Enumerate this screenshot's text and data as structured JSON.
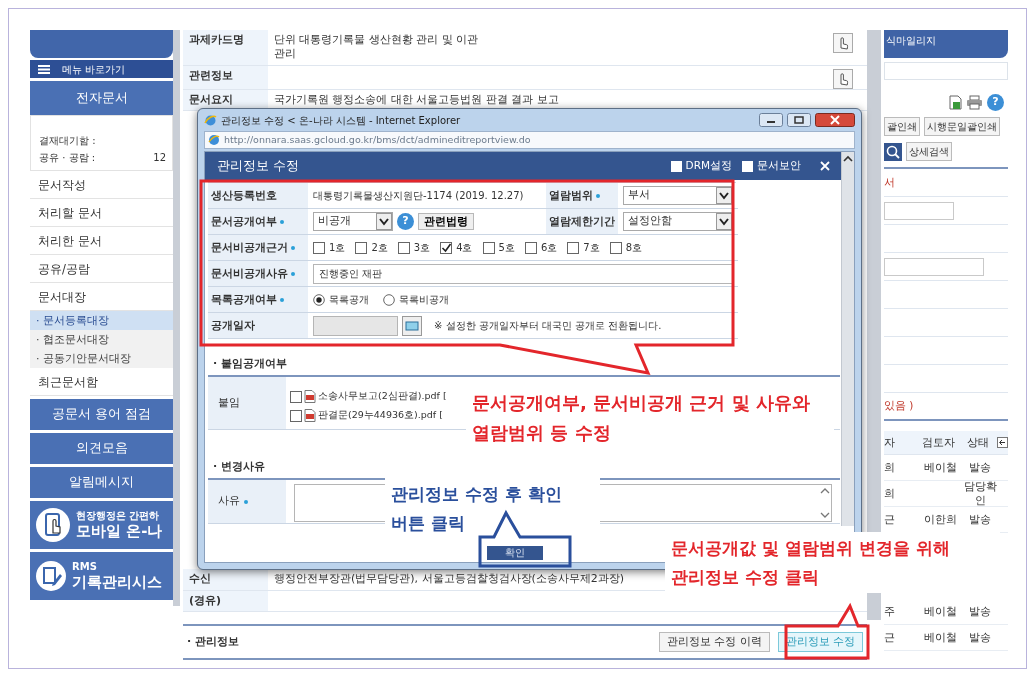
{
  "sidebar": {
    "menu_shortcut": "메뉴 바로가기",
    "section_title": "전자문서",
    "counters": [
      {
        "label": "결재대기함 :"
      },
      {
        "label": "공유 · 공람 :",
        "value": "12"
      }
    ],
    "items": [
      {
        "label": "문서작성",
        "selected": false
      },
      {
        "label": "처리할 문서",
        "selected": false
      },
      {
        "label": "처리한 문서",
        "selected": false
      },
      {
        "label": "공유/공람",
        "selected": false
      },
      {
        "label": "문서대장",
        "selected": false,
        "children": [
          {
            "label": "· 문서등록대장",
            "selected": true
          },
          {
            "label": "· 협조문서대장",
            "selected": false
          },
          {
            "label": "· 공동기안문서대장",
            "selected": false
          }
        ]
      },
      {
        "label": "최근문서함",
        "selected": false
      }
    ],
    "buttons": [
      "공문서 용어 점검",
      "의견모음",
      "알림메시지"
    ],
    "banners": [
      {
        "kind": "mobile",
        "caption": "현장행정은 간편하",
        "title": "모바일 온-나"
      },
      {
        "kind": "records",
        "caption": "RMS",
        "title": "기록관리시스"
      }
    ]
  },
  "document": {
    "rows": [
      {
        "label": "과제카드명",
        "lines": [
          "단위 대통령기록물 생산현황 관리 및 이관",
          "관리"
        ],
        "action": true
      },
      {
        "label": "관련정보",
        "action": true
      },
      {
        "label": "문서요지",
        "lines": [
          "국가기록원 행정소송에 대한 서울고등법원 판결 결과 보고"
        ],
        "action": false
      }
    ],
    "bottom_rows": [
      {
        "label": "수신",
        "lines": [
          "행정안전부장관(법무담당관), 서울고등검찰청검사장(소송사무제2과장)"
        ]
      },
      {
        "label": "(경유)"
      }
    ],
    "section_title": "· 관리정보",
    "buttons": [
      {
        "label": "관리정보 수정 이력",
        "kind": "default"
      },
      {
        "label": "관리정보 수정",
        "kind": "highlight"
      }
    ]
  },
  "right_panel": {
    "tab": "식마일리지",
    "help": "?",
    "buttons": [
      "괄인쇄",
      "시행문일괄인쇄"
    ],
    "detail_search": "상세검색",
    "notes": [
      "서",
      "있음 )"
    ],
    "columns": [
      "자",
      "검토자",
      "상태"
    ],
    "rows": [
      {
        "col_1": "희",
        "reviewer": "베이철",
        "status": "발송"
      },
      {
        "col_1": "희",
        "status": "담당확인"
      },
      {
        "col_1": "근",
        "reviewer": "이한희",
        "status": "발송"
      },
      {
        "col_1": "주",
        "reviewer": "베이철",
        "status": "발송"
      },
      {
        "col_1": "근",
        "reviewer": "베이철",
        "status": "발송"
      }
    ]
  },
  "dialog": {
    "window_title": "관리정보 수정 < 온-나라 시스템 - Internet Explorer",
    "address": "http://onnara.saas.gcloud.go.kr/bms/dct/admineditreportview.do",
    "title": "관리정보 수정",
    "options": [
      {
        "label": "DRM설정",
        "checked": false
      },
      {
        "label": "문서보안",
        "checked": false
      }
    ],
    "form": [
      {
        "kind": "text",
        "label": "생산등록번호",
        "required": false,
        "value": "대통령기록물생산지원단-1174 (2019. 12.27)",
        "side_label": "열람범위",
        "side_required": true,
        "side_select": "부서"
      },
      {
        "kind": "select",
        "label": "문서공개여부",
        "required": true,
        "select": "비공개",
        "help": "?",
        "button": "관련법령",
        "side_label": "열람제한기간",
        "side_required": false,
        "side_select": "설정안함"
      },
      {
        "kind": "checkboxes",
        "label": "문서비공개근거",
        "required": true,
        "options": [
          {
            "label": "1호",
            "checked": false
          },
          {
            "label": "2호",
            "checked": false
          },
          {
            "label": "3호",
            "checked": false
          },
          {
            "label": "4호",
            "checked": true
          },
          {
            "label": "5호",
            "checked": false
          },
          {
            "label": "6호",
            "checked": false
          },
          {
            "label": "7호",
            "checked": false
          },
          {
            "label": "8호",
            "checked": false
          }
        ]
      },
      {
        "kind": "input",
        "label": "문서비공개사유",
        "required": true,
        "value": "진행중인 재판"
      },
      {
        "kind": "radios",
        "label": "목록공개여부",
        "required": true,
        "options": [
          {
            "label": "목록공개",
            "selected": true
          },
          {
            "label": "목록비공개",
            "selected": false
          }
        ]
      },
      {
        "kind": "date",
        "label": "공개일자",
        "required": false,
        "disabled": true,
        "note": "※ 설정한 공개일자부터 대국민 공개로 전환됩니다."
      }
    ],
    "attachments": {
      "title": "· 붙임공개여부",
      "label": "붙임",
      "files": [
        {
          "name": "소송사무보고(2심판결).pdf [",
          "checked": false
        },
        {
          "name": "판결문(29누44936호).pdf [",
          "checked": false
        }
      ]
    },
    "reason": {
      "title": "· 변경사유",
      "label": "사유",
      "required": true
    },
    "confirm": "확인"
  },
  "annotations": [
    {
      "color": "#e3262b",
      "lines": [
        "문서공개여부, 문서비공개 근거 및 사유와",
        "열람범위 등 수정"
      ]
    },
    {
      "color": "#2a4f9c",
      "lines": [
        "관리정보 수정 후 확인",
        "버튼 클릭"
      ]
    },
    {
      "color": "#e3262b",
      "lines": [
        "문서공개값 및 열람범위 변경을 위해",
        "관리정보 수정 클릭"
      ]
    }
  ]
}
